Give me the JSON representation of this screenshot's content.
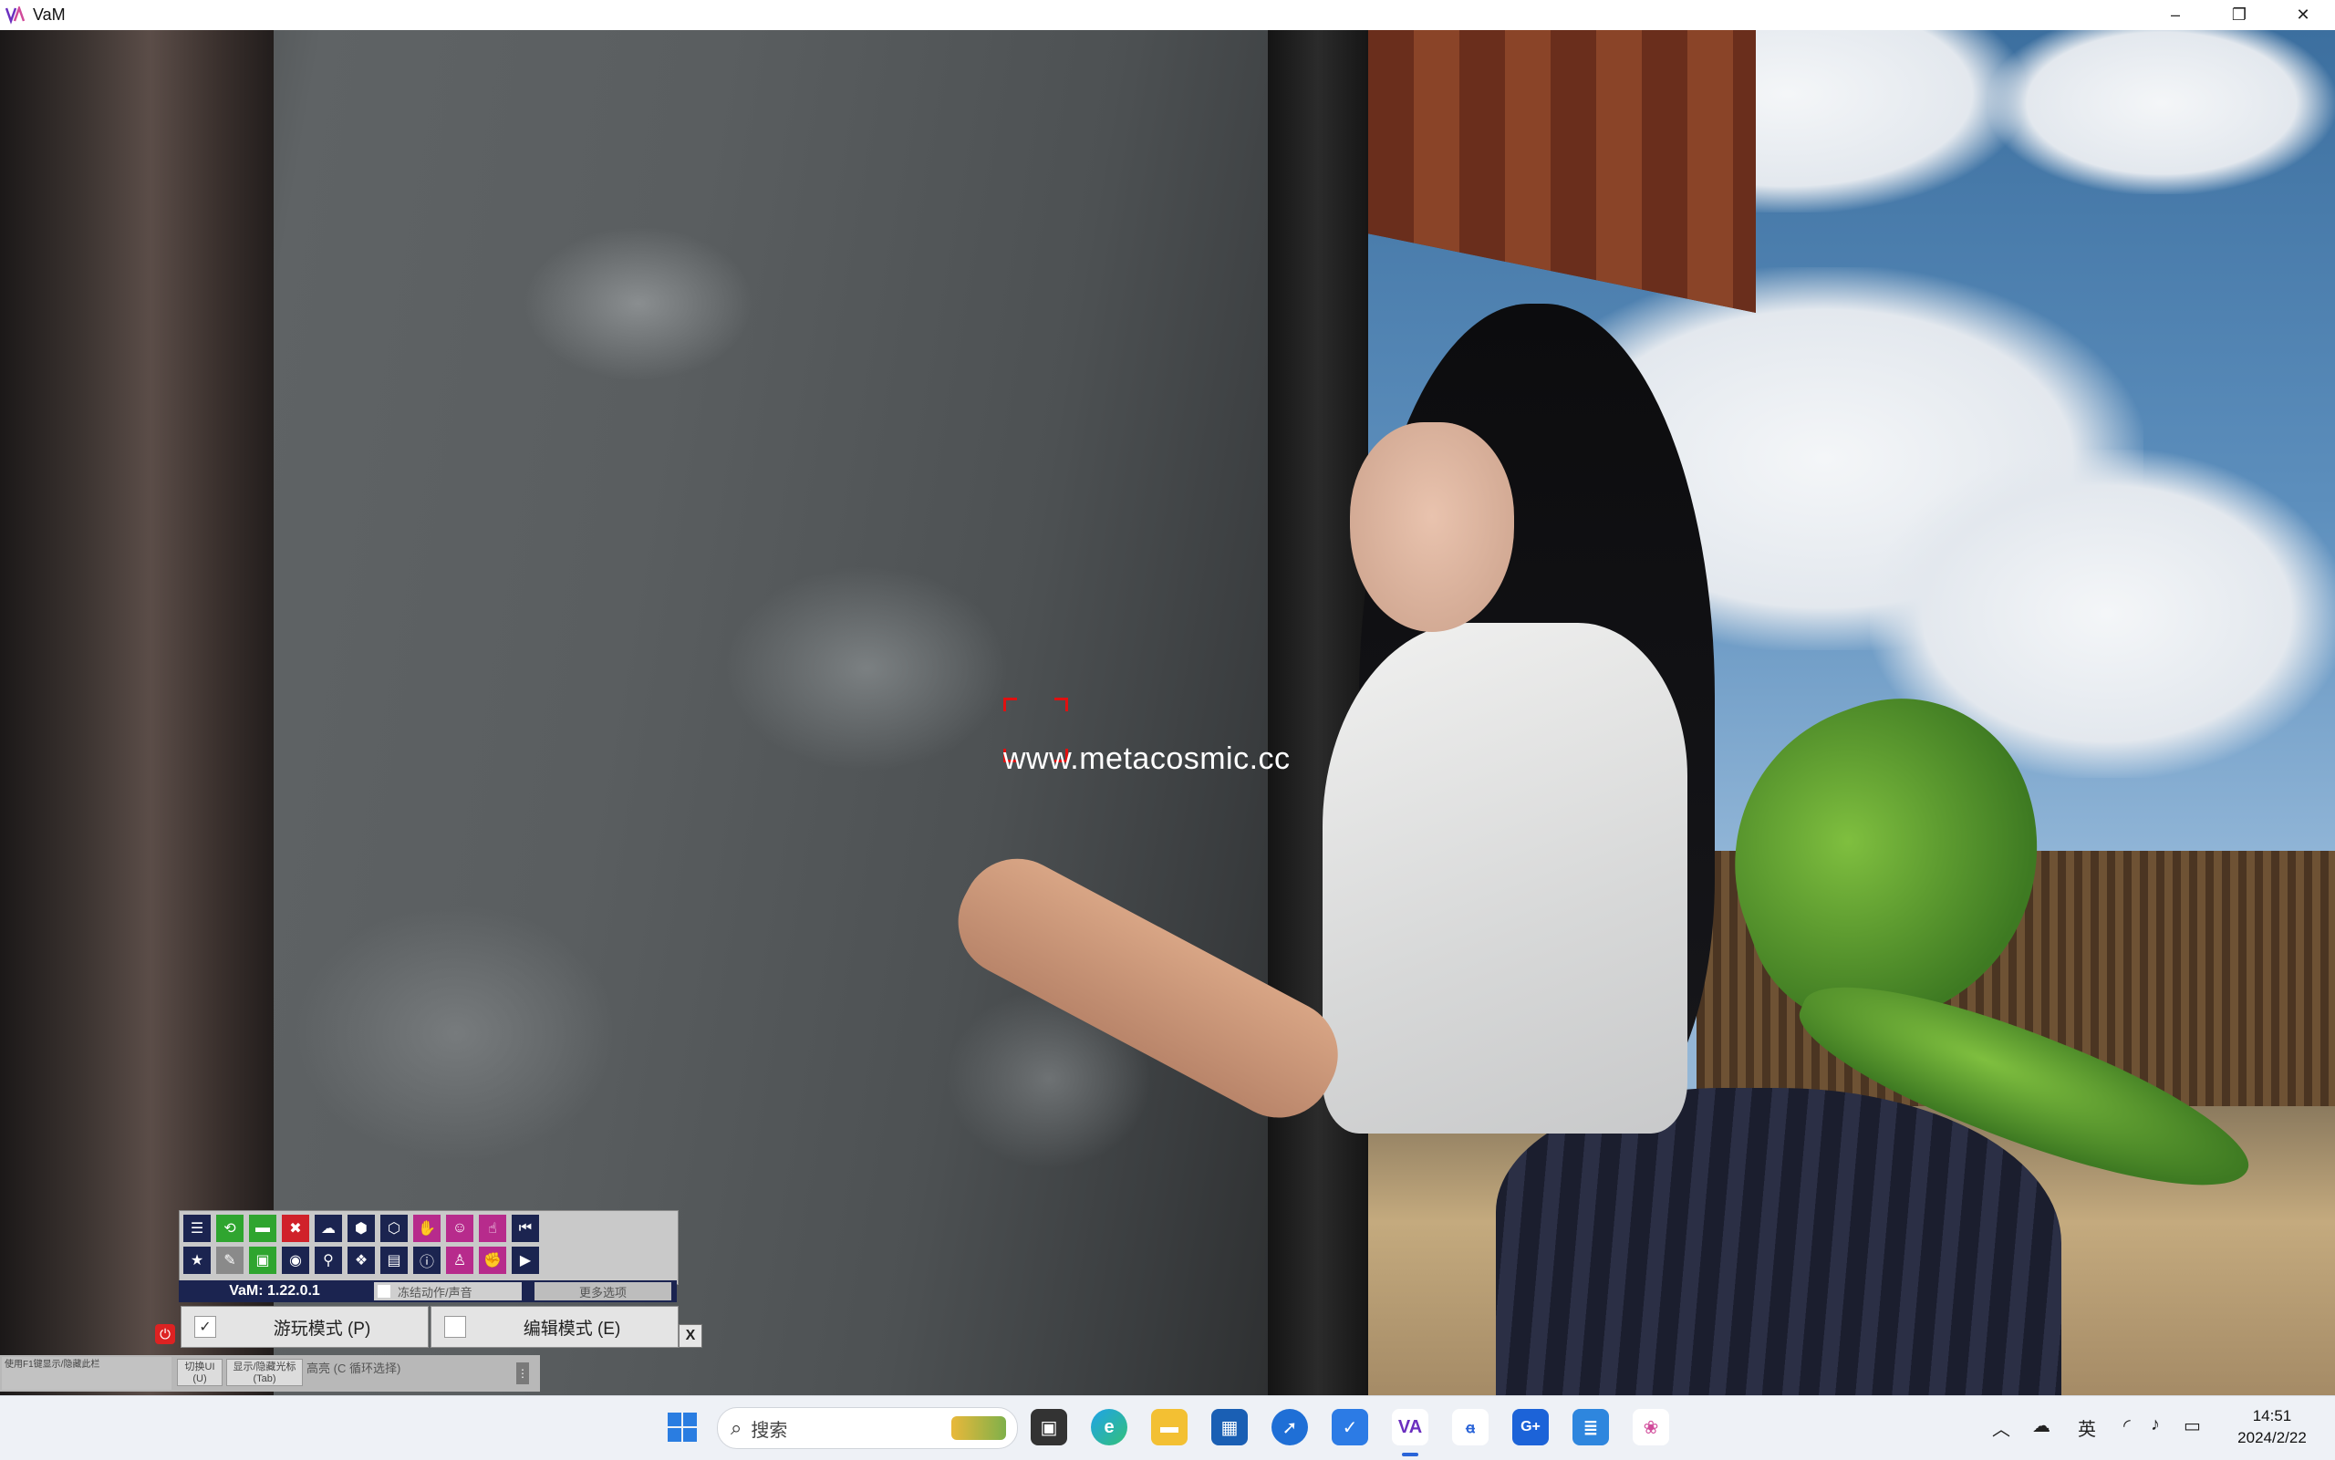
{
  "window": {
    "title": "VaM",
    "controls": {
      "minimize": "–",
      "maximize": "❐",
      "close": "✕"
    }
  },
  "scene": {
    "watermark": "www.metacosmic.cc"
  },
  "vam_ui": {
    "toolbar_row1_icons": [
      "menu-icon",
      "load-scene-icon",
      "folder-icon",
      "delete-icon",
      "upload-icon",
      "package-icon",
      "packages-icon",
      "hand-icon",
      "person-icon",
      "pointer-icon",
      "rewind-icon"
    ],
    "toolbar_row2_icons": [
      "star-icon",
      "open-icon",
      "screenshot-folder-icon",
      "camera-icon",
      "nodes-icon",
      "gift-icon",
      "document-icon",
      "info-icon",
      "user-icon",
      "grab-icon",
      "play-icon"
    ],
    "toolbar_row1_colors": [
      "#1b2450",
      "#2fa52f",
      "#2fa52f",
      "#d0212a",
      "#1b2450",
      "#1b2450",
      "#1b2450",
      "#b72b8c",
      "#b72b8c",
      "#b72b8c",
      "#1b2450"
    ],
    "toolbar_row2_colors": [
      "#1b2450",
      "#8a8a8a",
      "#2fa52f",
      "#1b2450",
      "#1b2450",
      "#1b2450",
      "#1b2450",
      "#1b2450",
      "#b72b8c",
      "#b72b8c",
      "#1b2450"
    ],
    "version": "VaM: 1.22.0.1",
    "freeze_label": "冻结动作/声音",
    "more_options": "更多选项",
    "play_mode": "游玩模式 (P)",
    "edit_mode": "编辑模式 (E)",
    "play_checked": "✓",
    "close": "X",
    "power": "⏻",
    "hint_f1": "使用F1键显示/隐藏此栏",
    "toggle_ui": "切换UI\n(U)",
    "toggle_cursor": "显示/隐藏光标\n(Tab)",
    "highlight": "高亮 (C 循环选择)",
    "menu_dots": "⋮"
  },
  "taskbar": {
    "search_placeholder": "搜索",
    "ime": "英",
    "time": "14:51",
    "date": "2024/2/22",
    "app_colors": {
      "windows": "#2a7de1",
      "vam": "#6b2fbf",
      "store": "#1a5fb4"
    }
  }
}
